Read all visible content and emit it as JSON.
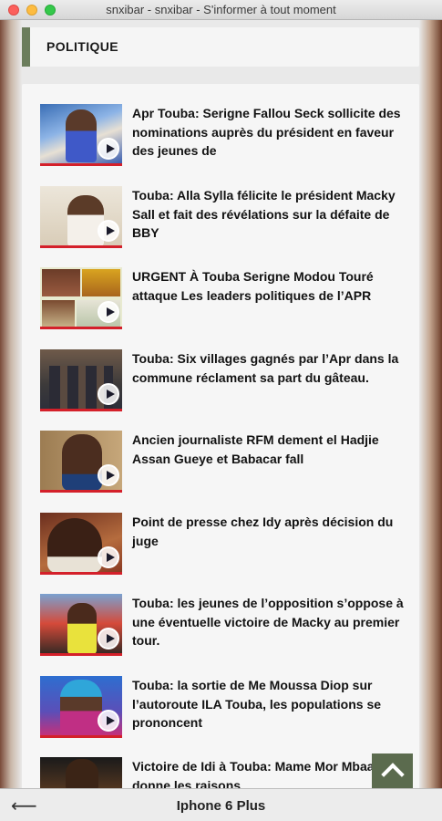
{
  "window": {
    "title": "snxibar - snxibar - S'informer à tout moment"
  },
  "section": {
    "title": "POLITIQUE"
  },
  "articles": [
    {
      "title": "Apr Touba: Serigne Fallou Seck sollicite des nominations auprès du président en faveur des jeunes de",
      "has_video": true
    },
    {
      "title": "Touba: Alla Sylla félicite le président Macky Sall et fait des révélations sur la défaite de BBY",
      "has_video": true
    },
    {
      "title": "URGENT À Touba Serigne Modou Touré attaque Les leaders politiques de l’APR",
      "has_video": true
    },
    {
      "title": "Touba: Six villages gagnés par l’Apr dans la commune réclament sa part du gâteau.",
      "has_video": true
    },
    {
      "title": "Ancien journaliste RFM dement el Hadjie Assan Gueye et Babacar fall",
      "has_video": true
    },
    {
      "title": "Point de presse chez Idy après décision du juge",
      "has_video": true
    },
    {
      "title": "Touba: les jeunes de l’opposition s’oppose à une éventuelle victoire de Macky au premier tour.",
      "has_video": true
    },
    {
      "title": "Touba: la sortie de Me Moussa Diop sur l’autoroute ILA Touba, les populations se prononcent",
      "has_video": true
    },
    {
      "title": "Victoire de Idi à Touba: Mame Mor Mbaaye donne les raisons",
      "has_video": false
    }
  ],
  "bottombar": {
    "back_symbol": "⟵",
    "device_label": "Iphone 6 Plus"
  },
  "colors": {
    "section_accent": "#6b7d5c",
    "thumb_underline": "#d4202a",
    "back_to_top": "#5b6b4e"
  },
  "icons": {
    "play": "play-icon",
    "back_to_top": "chevron-up-icon"
  }
}
